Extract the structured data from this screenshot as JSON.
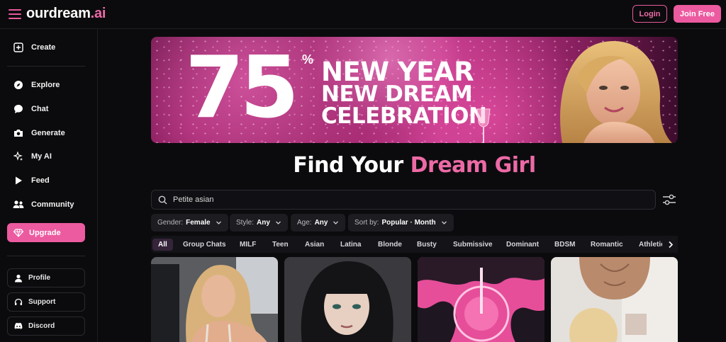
{
  "brand": {
    "name_main": "ourdream",
    "name_accent": ".ai"
  },
  "header": {
    "login_label": "Login",
    "join_label": "Join Free"
  },
  "sidebar": {
    "create_label": "Create",
    "items": [
      {
        "label": "Explore",
        "icon": "compass-icon"
      },
      {
        "label": "Chat",
        "icon": "chat-bubble-icon"
      },
      {
        "label": "Generate",
        "icon": "camera-icon"
      },
      {
        "label": "My AI",
        "icon": "sparkles-icon"
      },
      {
        "label": "Feed",
        "icon": "play-icon"
      },
      {
        "label": "Community",
        "icon": "users-icon"
      }
    ],
    "upgrade_label": "Upgrade",
    "bottom": [
      {
        "label": "Profile",
        "icon": "user-icon"
      },
      {
        "label": "Support",
        "icon": "headset-icon"
      },
      {
        "label": "Discord",
        "icon": "discord-icon"
      }
    ]
  },
  "banner": {
    "discount": "75",
    "percent": "%",
    "line1": "NEW YEAR",
    "line2": "NEW DREAM",
    "line3": "CELEBRATION"
  },
  "headline": {
    "part1": "Find Your ",
    "part2": "Dream Girl"
  },
  "search": {
    "value": "Petite asian"
  },
  "filters": [
    {
      "label": "Gender:",
      "value": "Female"
    },
    {
      "label": "Style:",
      "value": "Any"
    },
    {
      "label": "Age:",
      "value": "Any"
    },
    {
      "label": "Sort by:",
      "value": "Popular · Month"
    }
  ],
  "chips": [
    "All",
    "Group Chats",
    "MILF",
    "Teen",
    "Asian",
    "Latina",
    "Blonde",
    "Busty",
    "Submissive",
    "Dominant",
    "BDSM",
    "Romantic",
    "Athletic"
  ],
  "colors": {
    "accent": "#ec5aa0",
    "background": "#0b0b0d"
  }
}
